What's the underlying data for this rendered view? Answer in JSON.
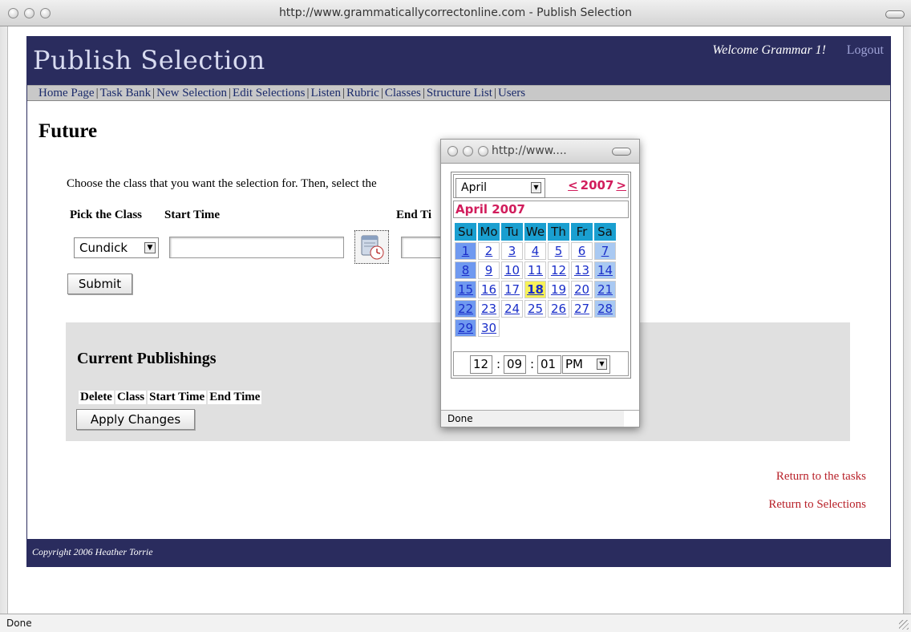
{
  "browser": {
    "window_title": "http://www.grammaticallycorrectonline.com - Publish Selection",
    "status": "Done"
  },
  "header": {
    "site_title": "Publish Selection",
    "welcome": "Welcome Grammar 1!",
    "logout": "Logout"
  },
  "nav": {
    "items": [
      "Home Page",
      "Task Bank",
      "New Selection",
      "Edit Selections",
      "Listen",
      "Rubric",
      "Classes",
      "Structure List",
      "Users"
    ],
    "separator": "|"
  },
  "main": {
    "heading": "Future",
    "instructions": "Choose the class that you want the selection for. Then, select the",
    "pick_class_label": "Pick the Class",
    "start_time_label": "Start Time",
    "end_time_label": "End Ti",
    "class_selected": "Cundick",
    "start_time_value": "",
    "end_time_value": "",
    "submit_label": "Submit"
  },
  "publishings": {
    "title": "Current Publishings",
    "columns": [
      "Delete",
      "Class",
      "Start Time",
      "End Time"
    ],
    "apply_label": "Apply Changes"
  },
  "links": {
    "return_tasks": "Return to the tasks",
    "return_selections": "Return to Selections"
  },
  "footer": {
    "copyright": "Copyright 2006 Heather Torrie"
  },
  "popup": {
    "window_title": "http://www....",
    "status": "Done",
    "month_selected": "April",
    "prev_year": "<",
    "year": "2007",
    "next_year": ">",
    "month_label": "April 2007",
    "weekdays": [
      "Su",
      "Mo",
      "Tu",
      "We",
      "Th",
      "Fr",
      "Sa"
    ],
    "weeks": [
      [
        "1",
        "2",
        "3",
        "4",
        "5",
        "6",
        "7"
      ],
      [
        "8",
        "9",
        "10",
        "11",
        "12",
        "13",
        "14"
      ],
      [
        "15",
        "16",
        "17",
        "18",
        "19",
        "20",
        "21"
      ],
      [
        "22",
        "23",
        "24",
        "25",
        "26",
        "27",
        "28"
      ],
      [
        "29",
        "30",
        "",
        "",
        "",
        "",
        ""
      ]
    ],
    "today": "18",
    "time": {
      "hour": "12",
      "minute": "09",
      "second": "01",
      "ampm": "PM",
      "sep": ":"
    }
  },
  "colors": {
    "header_bg": "#2a2c5e",
    "nav_bg": "#c8c8c8",
    "link_red": "#b8222a",
    "calendar_accent": "#d11d5c",
    "weekday_header": "#1a9fd0",
    "today_highlight": "#f7f25a"
  },
  "icons": {
    "calendar_button": "calendar-clock-icon",
    "resize": "resize-grip-icon"
  }
}
